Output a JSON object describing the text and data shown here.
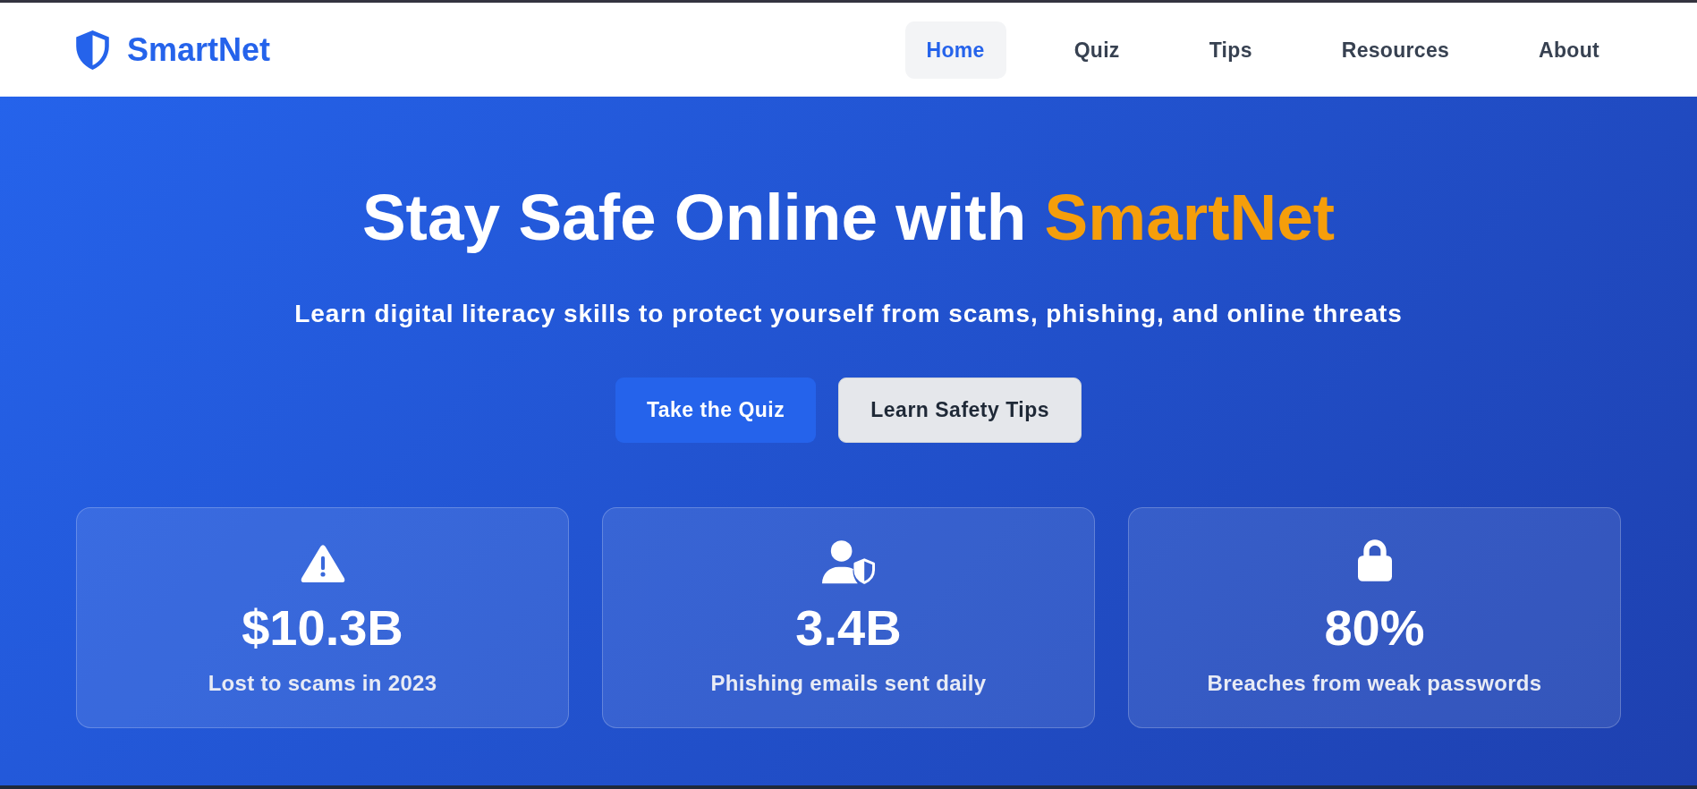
{
  "brand": {
    "name": "SmartNet"
  },
  "nav": [
    {
      "label": "Home",
      "selected": true
    },
    {
      "label": "Quiz",
      "selected": false
    },
    {
      "label": "Tips",
      "selected": false
    },
    {
      "label": "Resources",
      "selected": false
    },
    {
      "label": "About",
      "selected": false
    }
  ],
  "hero": {
    "title": "Stay Safe Online with ",
    "title_highlight": "SmartNet",
    "subtitle": "Learn digital literacy skills to protect yourself from scams, phishing, and online threats"
  },
  "buttons": [
    {
      "label": "Take the Quiz",
      "kind": "primary"
    },
    {
      "label": "Learn Safety Tips",
      "kind": "secondary"
    }
  ],
  "stats": [
    {
      "value": "$10.3B",
      "label": "Lost to scams in 2023"
    },
    {
      "value": "3.4B",
      "label": "Phishing emails sent daily"
    },
    {
      "value": "80%",
      "label": "Breaches from weak passwords"
    }
  ]
}
